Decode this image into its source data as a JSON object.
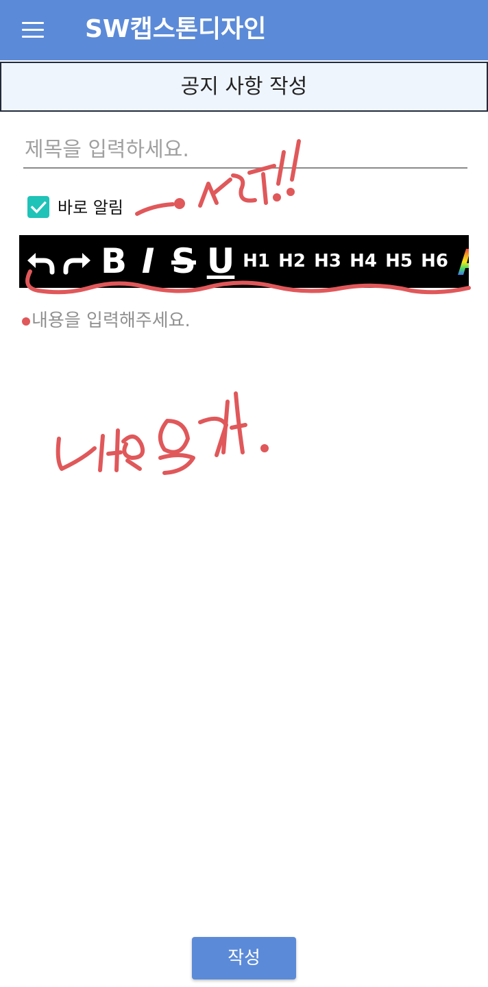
{
  "appbar": {
    "title": "SW캡스톤디자인"
  },
  "page_header": {
    "title": "공지 사항 작성"
  },
  "form": {
    "title_placeholder": "제목을 입력하세요.",
    "title_value": "",
    "notify_label": "바로 알림",
    "notify_checked": true,
    "content_placeholder": "내용을 입력해주세요."
  },
  "toolbar": {
    "items": [
      {
        "name": "undo",
        "icon": "undo-icon"
      },
      {
        "name": "redo",
        "icon": "redo-icon"
      },
      {
        "name": "bold",
        "label": "B"
      },
      {
        "name": "italic",
        "label": "I"
      },
      {
        "name": "strikethrough",
        "label": "S"
      },
      {
        "name": "underline",
        "label": "U"
      },
      {
        "name": "heading-1",
        "label": "H1"
      },
      {
        "name": "heading-2",
        "label": "H2"
      },
      {
        "name": "heading-3",
        "label": "H3"
      },
      {
        "name": "heading-4",
        "label": "H4"
      },
      {
        "name": "heading-5",
        "label": "H5"
      },
      {
        "name": "heading-6",
        "label": "H6"
      },
      {
        "name": "text-color",
        "label": "A"
      }
    ]
  },
  "submit": {
    "label": "작성"
  },
  "colors": {
    "primary": "#5b8ad8",
    "header_bg": "#eff5fd",
    "checkbox": "#1fc3b8",
    "toolbar_bg": "#000000",
    "annotation": "#e0585a"
  }
}
